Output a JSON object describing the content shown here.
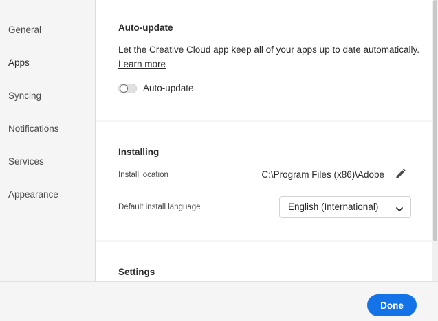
{
  "sidebar": {
    "items": [
      {
        "label": "General"
      },
      {
        "label": "Apps"
      },
      {
        "label": "Syncing"
      },
      {
        "label": "Notifications"
      },
      {
        "label": "Services"
      },
      {
        "label": "Appearance"
      }
    ]
  },
  "auto_update": {
    "title": "Auto-update",
    "description": "Let the Creative Cloud app keep all of your apps up to date automatically.",
    "learn_more": "Learn more",
    "toggle_label": "Auto-update",
    "toggle_on": false
  },
  "installing": {
    "title": "Installing",
    "install_location_label": "Install location",
    "install_location_value": "C:\\Program Files (x86)\\Adobe",
    "language_label": "Default install language",
    "language_value": "English (International)"
  },
  "settings": {
    "title": "Settings"
  },
  "footer": {
    "done_label": "Done"
  },
  "colors": {
    "accent": "#1473e6",
    "panel": "#ffffff",
    "background": "#f5f5f5"
  },
  "icons": {
    "edit": "pencil-icon",
    "dropdown": "chevron-down-icon"
  }
}
